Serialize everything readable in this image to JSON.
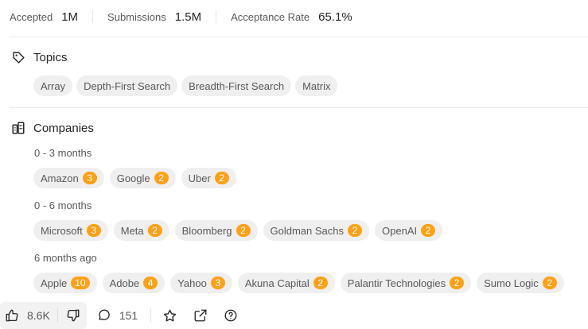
{
  "stats": [
    {
      "label": "Accepted",
      "value": "1M"
    },
    {
      "label": "Submissions",
      "value": "1.5M"
    },
    {
      "label": "Acceptance Rate",
      "value": "65.1%"
    }
  ],
  "topics": {
    "title": "Topics",
    "tags": [
      "Array",
      "Depth-First Search",
      "Breadth-First Search",
      "Matrix"
    ]
  },
  "companies": {
    "title": "Companies",
    "groups": [
      {
        "period": "0 - 3 months",
        "items": [
          {
            "name": "Amazon",
            "count": "3"
          },
          {
            "name": "Google",
            "count": "2"
          },
          {
            "name": "Uber",
            "count": "2"
          }
        ]
      },
      {
        "period": "0 - 6 months",
        "items": [
          {
            "name": "Microsoft",
            "count": "3"
          },
          {
            "name": "Meta",
            "count": "2"
          },
          {
            "name": "Bloomberg",
            "count": "2"
          },
          {
            "name": "Goldman Sachs",
            "count": "2"
          },
          {
            "name": "OpenAI",
            "count": "2"
          }
        ]
      },
      {
        "period": "6 months ago",
        "items": [
          {
            "name": "Apple",
            "count": "10"
          },
          {
            "name": "Adobe",
            "count": "4"
          },
          {
            "name": "Yahoo",
            "count": "3"
          },
          {
            "name": "Akuna Capital",
            "count": "2"
          },
          {
            "name": "Palantir Technologies",
            "count": "2"
          },
          {
            "name": "Sumo Logic",
            "count": "2"
          }
        ]
      }
    ]
  },
  "actions": {
    "likes": "8.6K",
    "comments": "151",
    "icons": [
      "thumbs-up-icon",
      "thumbs-down-icon",
      "comment-icon",
      "star-icon",
      "share-icon",
      "help-icon"
    ]
  },
  "colors": {
    "badge": "#ffa116",
    "chip_bg": "#efefef"
  }
}
